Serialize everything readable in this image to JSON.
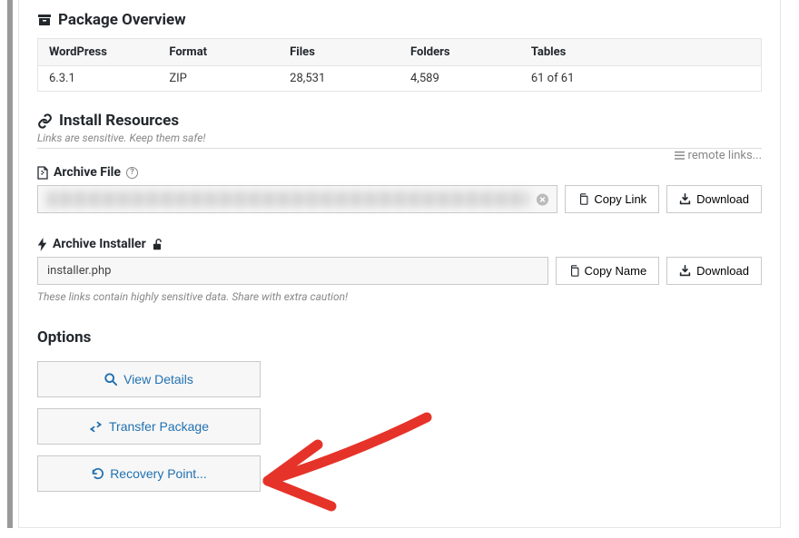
{
  "overview": {
    "title": "Package Overview",
    "headers": {
      "wordpress": "WordPress",
      "format": "Format",
      "files": "Files",
      "folders": "Folders",
      "tables": "Tables"
    },
    "values": {
      "wordpress": "6.3.1",
      "format": "ZIP",
      "files": "28,531",
      "folders": "4,589",
      "tables": "61 of 61"
    }
  },
  "install": {
    "title": "Install Resources",
    "subtitle": "Links are sensitive. Keep them safe!",
    "remote_links": "remote links..."
  },
  "archive_file": {
    "label": "Archive File",
    "copy_link": "Copy Link",
    "download": "Download"
  },
  "archive_installer": {
    "label": "Archive Installer",
    "value": "installer.php",
    "copy_name": "Copy Name",
    "download": "Download",
    "caution": "These links contain highly sensitive data. Share with extra caution!"
  },
  "options": {
    "title": "Options",
    "view_details": "View Details",
    "transfer": "Transfer Package",
    "recovery": "Recovery Point..."
  }
}
